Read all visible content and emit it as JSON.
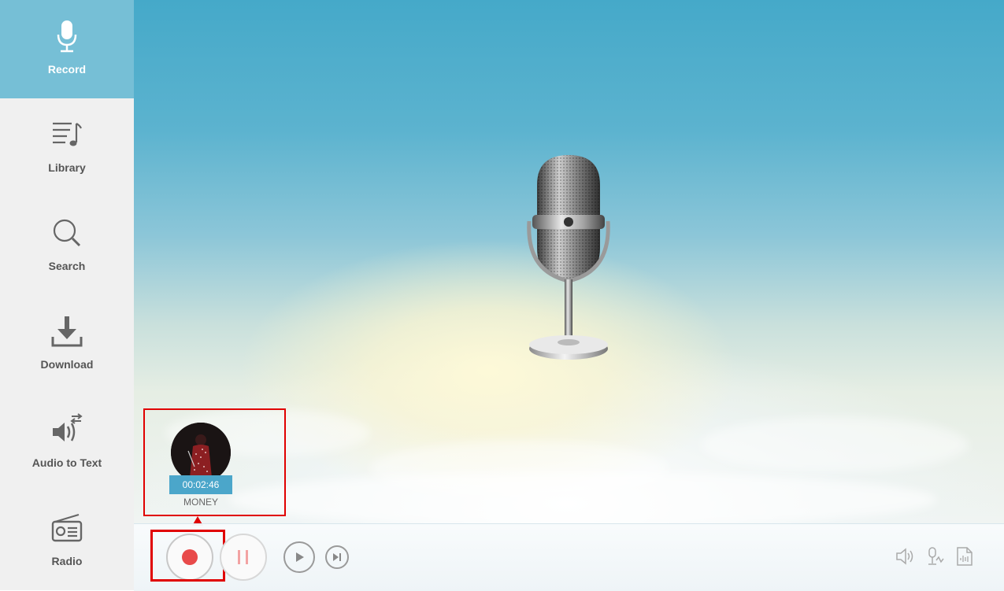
{
  "sidebar": {
    "items": [
      {
        "label": "Record",
        "icon": "microphone-icon",
        "active": true
      },
      {
        "label": "Library",
        "icon": "music-list-icon",
        "active": false
      },
      {
        "label": "Search",
        "icon": "search-icon",
        "active": false
      },
      {
        "label": "Download",
        "icon": "download-icon",
        "active": false
      },
      {
        "label": "Audio to Text",
        "icon": "speaker-transfer-icon",
        "active": false
      },
      {
        "label": "Radio",
        "icon": "radio-icon",
        "active": false
      }
    ]
  },
  "recording": {
    "duration": "00:02:46",
    "title": "MONEY"
  },
  "controls": {
    "record": "record-button",
    "pause": "pause-button",
    "play": "play-button",
    "next": "next-button"
  },
  "utilities": [
    "volume-icon",
    "microphone-settings-icon",
    "audio-file-icon"
  ],
  "colors": {
    "accent": "#76bfd6",
    "record_red": "#e84a4a",
    "highlight": "#e00000",
    "badge": "#4ba6ca"
  }
}
